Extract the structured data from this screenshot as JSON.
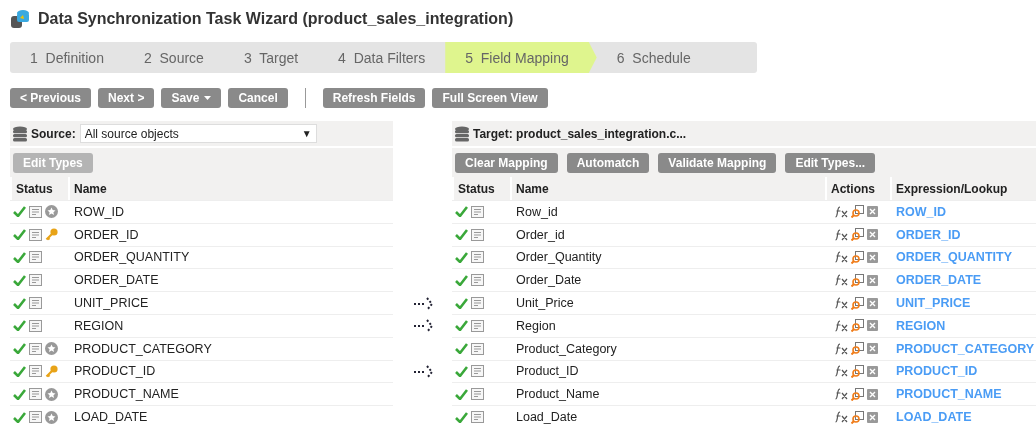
{
  "window": {
    "title": "Data Synchronization Task Wizard (product_sales_integration)"
  },
  "steps": [
    {
      "label": "1  Definition",
      "selected": false
    },
    {
      "label": "2  Source",
      "selected": false
    },
    {
      "label": "3  Target",
      "selected": false
    },
    {
      "label": "4  Data Filters",
      "selected": false
    },
    {
      "label": "5  Field Mapping",
      "selected": true
    },
    {
      "label": "6  Schedule",
      "selected": false
    }
  ],
  "toolbar": {
    "buttons": [
      "< Previous",
      "Next >",
      "Save"
    ],
    "cancel": "Cancel",
    "extra": [
      "Refresh Fields",
      "Full Screen View"
    ]
  },
  "source": {
    "label": "Source:",
    "value": "All source objects",
    "caret": "▼",
    "edit_types": {
      "label": "Edit Types",
      "disabled": true
    },
    "columns": [
      "Status",
      "Name"
    ],
    "rows": [
      {
        "name": "ROW_ID",
        "kind": "star",
        "arrow": false
      },
      {
        "name": "ORDER_ID",
        "kind": "key",
        "arrow": false
      },
      {
        "name": "ORDER_QUANTITY",
        "kind": "plain",
        "arrow": false
      },
      {
        "name": "ORDER_DATE",
        "kind": "plain",
        "arrow": false
      },
      {
        "name": "UNIT_PRICE",
        "kind": "plain",
        "arrow": true
      },
      {
        "name": "REGION",
        "kind": "plain",
        "arrow": true
      },
      {
        "name": "PRODUCT_CATEGORY",
        "kind": "star",
        "arrow": false
      },
      {
        "name": "PRODUCT_ID",
        "kind": "key",
        "arrow": true
      },
      {
        "name": "PRODUCT_NAME",
        "kind": "star",
        "arrow": false
      },
      {
        "name": "LOAD_DATE",
        "kind": "star",
        "arrow": false
      }
    ]
  },
  "target": {
    "label": "Target: product_sales_integration.c...",
    "buttons": [
      "Clear Mapping",
      "Automatch",
      "Validate Mapping",
      "Edit Types..."
    ],
    "columns": [
      "Status",
      "Name",
      "Actions",
      "Expression/Lookup"
    ],
    "rows": [
      {
        "name": "Row_id",
        "expression": "ROW_ID"
      },
      {
        "name": "Order_id",
        "expression": "ORDER_ID"
      },
      {
        "name": "Order_Quantity",
        "expression": "ORDER_QUANTITY"
      },
      {
        "name": "Order_Date",
        "expression": "ORDER_DATE"
      },
      {
        "name": "Unit_Price",
        "expression": "UNIT_PRICE"
      },
      {
        "name": "Region",
        "expression": "REGION"
      },
      {
        "name": "Product_Category",
        "expression": "PRODUCT_CATEGORY"
      },
      {
        "name": "Product_ID",
        "expression": "PRODUCT_ID"
      },
      {
        "name": "Product_Name",
        "expression": "PRODUCT_NAME"
      },
      {
        "name": "Load_Date",
        "expression": "LOAD_DATE"
      }
    ]
  }
}
